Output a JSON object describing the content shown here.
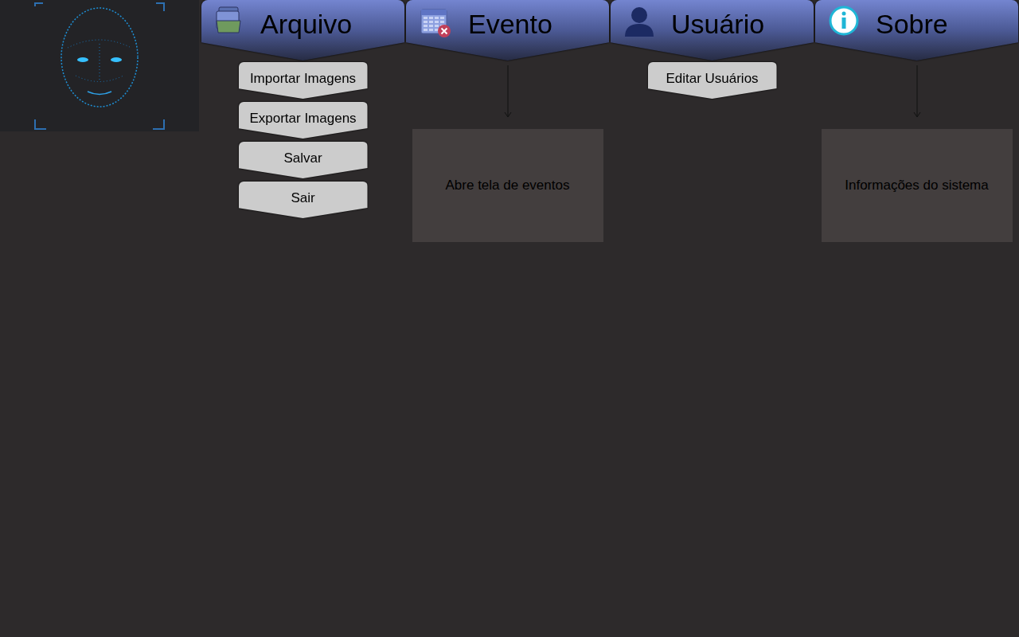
{
  "menus": [
    {
      "label": "Arquivo",
      "icon": "folder",
      "items": [
        "Importar Imagens",
        "Exportar Imagens",
        "Salvar",
        "Sair"
      ]
    },
    {
      "label": "Evento",
      "icon": "calendar",
      "items": [],
      "note": "Abre tela de eventos"
    },
    {
      "label": "Usuário",
      "icon": "user",
      "items": [
        "Editar Usuários"
      ]
    },
    {
      "label": "Sobre",
      "icon": "info",
      "items": [],
      "note": "Informações do sistema"
    }
  ]
}
